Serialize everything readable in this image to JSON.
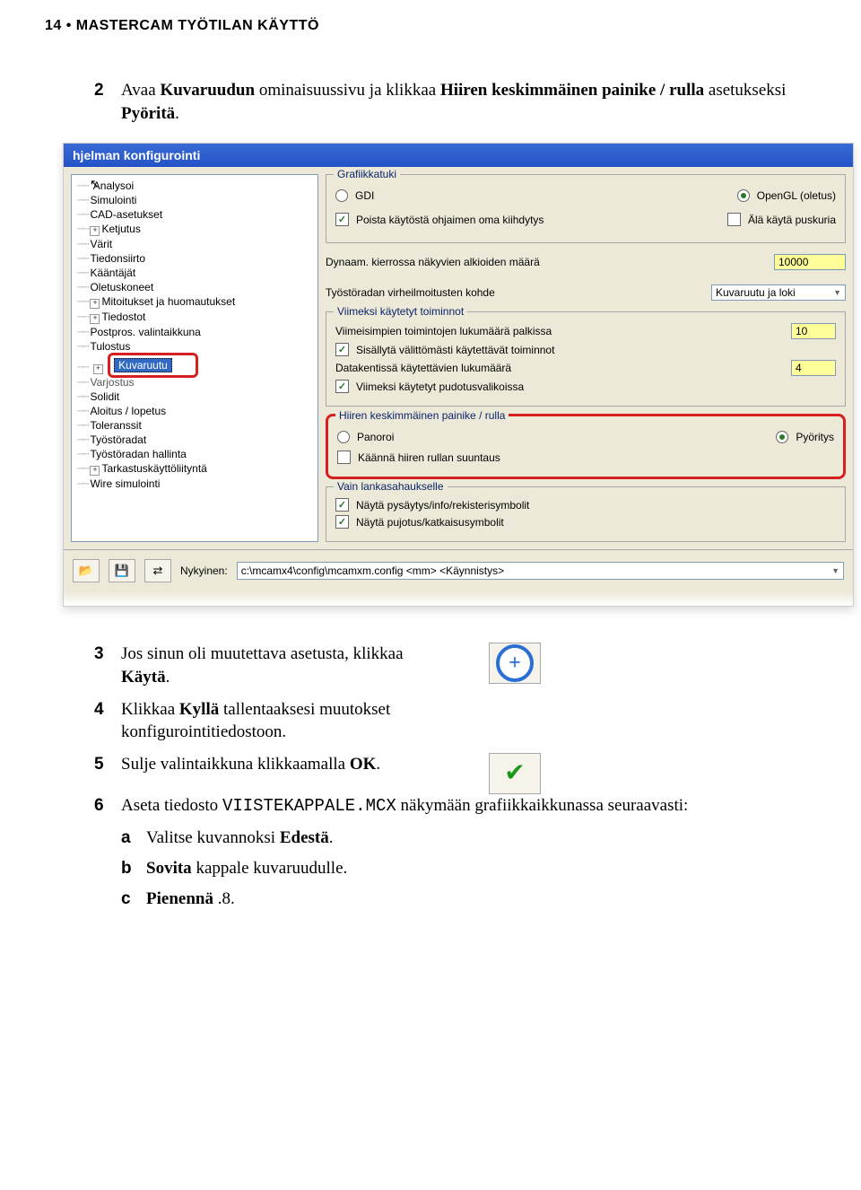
{
  "header": "14 • MASTERCAM TYÖTILAN KÄYTTÖ",
  "intro": {
    "num": "2",
    "pre": "Avaa ",
    "b1": "Kuvaruudun",
    "mid1": " ominaisuussivu ja klikkaa ",
    "b2": "Hiiren keskimmäinen painike / rulla",
    "mid2": " asetukseksi ",
    "b3": "Pyöritä",
    "post": "."
  },
  "dialog": {
    "title": "hjelman konfigurointi",
    "tree": {
      "items": [
        {
          "label": "Analysoi",
          "exp": false,
          "cursor": true
        },
        {
          "label": "Simulointi",
          "exp": false
        },
        {
          "label": "CAD-asetukset",
          "exp": false
        },
        {
          "label": "Ketjutus",
          "exp": true
        },
        {
          "label": "Värit",
          "exp": false
        },
        {
          "label": "Tiedonsiirto",
          "exp": false
        },
        {
          "label": "Kääntäjät",
          "exp": false
        },
        {
          "label": "Oletuskoneet",
          "exp": false
        },
        {
          "label": "Mitoitukset ja huomautukset",
          "exp": true
        },
        {
          "label": "Tiedostot",
          "exp": true
        },
        {
          "label": "Postpros. valintaikkuna",
          "exp": false
        },
        {
          "label": "Tulostus",
          "exp": false
        }
      ],
      "selected": "Kuvaruutu",
      "behind": "Varjostus",
      "items2": [
        {
          "label": "Solidit",
          "exp": false
        },
        {
          "label": "Aloitus / lopetus",
          "exp": false
        },
        {
          "label": "Toleranssit",
          "exp": false
        },
        {
          "label": "Työstöradat",
          "exp": false
        },
        {
          "label": "Työstöradan hallinta",
          "exp": false
        },
        {
          "label": "Tarkastuskäyttöliityntä",
          "exp": true
        },
        {
          "label": "Wire simulointi",
          "exp": false
        }
      ]
    },
    "g1": {
      "title": "Grafiikkatuki",
      "gdi": "GDI",
      "opengl": "OpenGL (oletus)",
      "cb1": "Poista käytöstä ohjaimen oma kiihdytys",
      "cb2": "Älä käytä puskuria"
    },
    "dyn": {
      "label": "Dynaam. kierrossa näkyvien alkioiden määrä",
      "value": "10000",
      "err_label": "Työstöradan virheilmoitusten kohde",
      "err_value": "Kuvaruutu ja loki"
    },
    "g2": {
      "title": "Viimeksi käytetyt toiminnot",
      "l1": "Viimeisimpien toimintojen lukumäärä palkissa",
      "v1": "10",
      "cb1": "Sisällytä välittömästi käytettävät toiminnot",
      "l2": "Datakentissä käytettävien lukumäärä",
      "v2": "4",
      "cb2": "Viimeksi käytetyt pudotusvalikoissa"
    },
    "g3": {
      "title": "Hiiren keskimmäinen painike / rulla",
      "r1": "Panoroi",
      "r2": "Pyöritys",
      "cb": "Käännä hiiren rullan suuntaus"
    },
    "g4": {
      "title": "Vain lankasahaukselle",
      "cb1": "Näytä pysäytys/info/rekisterisymbolit",
      "cb2": "Näytä pujotus/katkaisusymbolit"
    },
    "bottom": {
      "nyk": "Nykyinen:",
      "path": "c:\\mcamx4\\config\\mcamxm.config <mm> <Käynnistys>"
    }
  },
  "steps": {
    "s3": {
      "num": "3",
      "t1": "Jos sinun oli muutettava asetusta, klikkaa ",
      "b": "Käytä",
      "t2": "."
    },
    "s4": {
      "num": "4",
      "t1": "Klikkaa ",
      "b": "Kyllä",
      "t2": " tallentaaksesi muutokset konfigurointitiedostoon."
    },
    "s5": {
      "num": "5",
      "t1": "Sulje valintaikkuna klikkaamalla ",
      "b": "OK",
      "t2": "."
    },
    "s6": {
      "num": "6",
      "t1": "Aseta tiedosto ",
      "m": "VIISTEKAPPALE.MCX",
      "t2": " näkymään grafiikkaikkunassa seuraavasti:"
    },
    "subs": {
      "a": {
        "l": "a",
        "t1": "Valitse kuvannoksi ",
        "b": "Edestä",
        "t2": "."
      },
      "b": {
        "l": "b",
        "b1": "Sovita",
        "t": " kappale kuvaruudulle."
      },
      "c": {
        "l": "c",
        "b": "Pienennä",
        "t": " .8."
      }
    }
  }
}
